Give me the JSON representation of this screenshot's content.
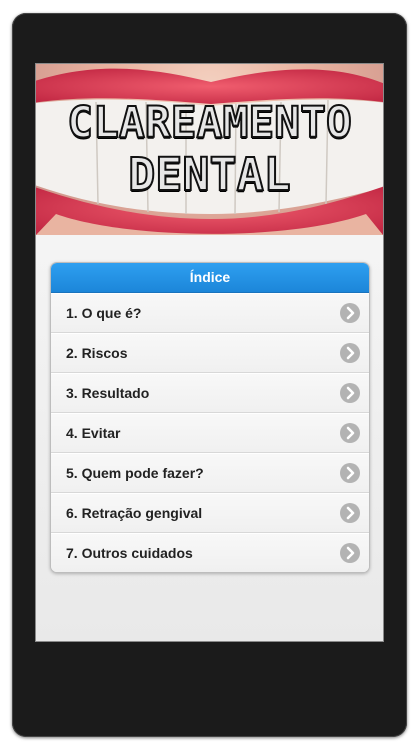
{
  "hero": {
    "title_line1": "CLAREAMENTO",
    "title_line2": "DENTAL"
  },
  "index": {
    "header": "Índice",
    "items": [
      {
        "label": "1. O que é?"
      },
      {
        "label": "2. Riscos"
      },
      {
        "label": "3. Resultado"
      },
      {
        "label": "4. Evitar"
      },
      {
        "label": "5. Quem pode fazer?"
      },
      {
        "label": "6. Retração gengival"
      },
      {
        "label": "7. Outros cuidados"
      }
    ],
    "item_icon": "chevron-right-icon"
  },
  "colors": {
    "header_blue": "#1c86d9",
    "frame": "#1b1b1b",
    "arrow_gray": "#b3b3b3"
  }
}
